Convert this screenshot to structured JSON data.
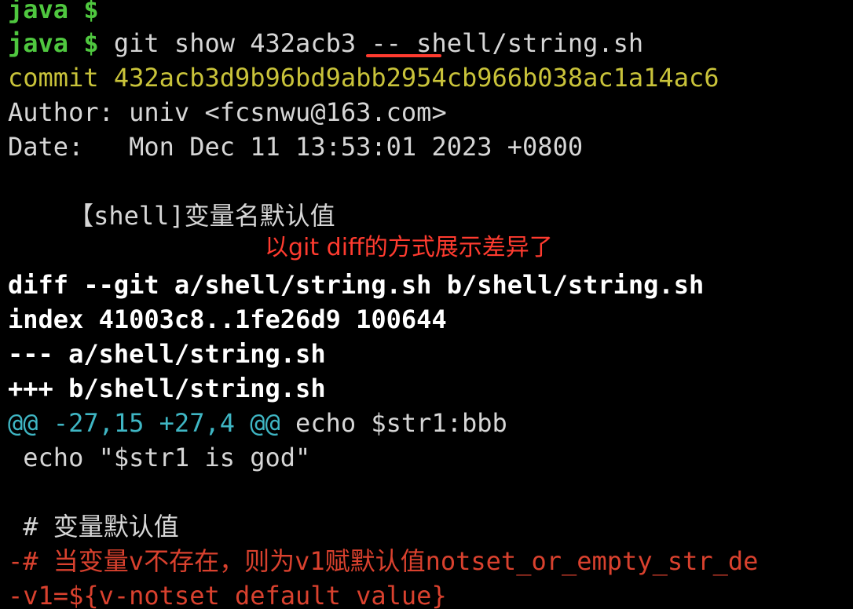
{
  "terminal": {
    "lines": {
      "l0": {
        "prompt": "java $",
        "cmd": ""
      },
      "l1": {
        "prompt": "java $",
        "cmd": " git show 432acb3 -- shell/string.sh"
      },
      "l2": "commit 432acb3d9b96bd9abb2954cb966b038ac1a14ac6",
      "l3": "Author: univ <fcsnwu@163.com>",
      "l4": "Date:   Mon Dec 11 13:53:01 2023 +0800",
      "l5": "    【shell]变量名默认值",
      "l6": "diff --git a/shell/string.sh b/shell/string.sh",
      "l7": "index 41003c8..1fe26d9 100644",
      "l8": "--- a/shell/string.sh",
      "l9": "+++ b/shell/string.sh",
      "l10": {
        "hunk": "@@ -27,15 +27,4 @@",
        "ctx": " echo $str1:bbb"
      },
      "l11": " echo \"$str1 is god\"",
      "l12": " # 变量默认值",
      "l13": "-# 当变量v不存在，则为v1赋默认值notset_or_empty_str_de",
      "l14": "-v1=${v-notset_default_value}"
    },
    "annotation": "以git diff的方式展示差异了"
  },
  "colors": {
    "background": "#000000",
    "prompt": "#4fc73f",
    "commit": "#c9c33a",
    "hunk": "#3fb6c4",
    "removed": "#d9412e",
    "annotation": "#ff3b2f"
  }
}
